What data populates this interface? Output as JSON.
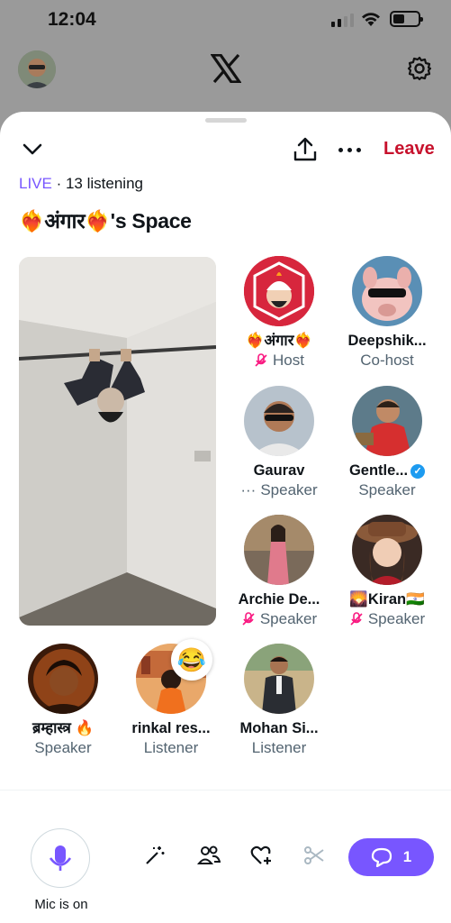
{
  "status_bar": {
    "time": "12:04"
  },
  "header": {
    "logo": "𝕏"
  },
  "space": {
    "live_label": "LIVE",
    "listening_text": "· 13 listening",
    "title": "❤️‍🔥अंगार❤️‍🔥's Space",
    "leave_label": "Leave"
  },
  "participants": [
    {
      "name": "❤️‍🔥अंगार❤️‍🔥",
      "role": "Host",
      "muted": true
    },
    {
      "name": "Deepshik...",
      "role": "Co-host",
      "muted": false
    },
    {
      "name": "Gaurav",
      "role": "Speaker",
      "prefix": "···"
    },
    {
      "name": "Gentle...",
      "role": "Speaker",
      "verified": true
    },
    {
      "name": "Archie De...",
      "role": "Speaker",
      "muted": true
    },
    {
      "name": "🌄Kiran🇮🇳",
      "role": "Speaker",
      "muted": true
    },
    {
      "name": "ब्रम्हास्त्र 🔥",
      "role": "Speaker"
    },
    {
      "name": "rinkal res...",
      "role": "Listener",
      "reaction": "😂"
    },
    {
      "name": "Mohan Si...",
      "role": "Listener"
    }
  ],
  "controls": {
    "mic_label": "Mic is on",
    "chat_count": "1"
  },
  "colors": {
    "accent": "#7856ff",
    "leave": "#c7112c",
    "verified": "#1d9bf0"
  }
}
